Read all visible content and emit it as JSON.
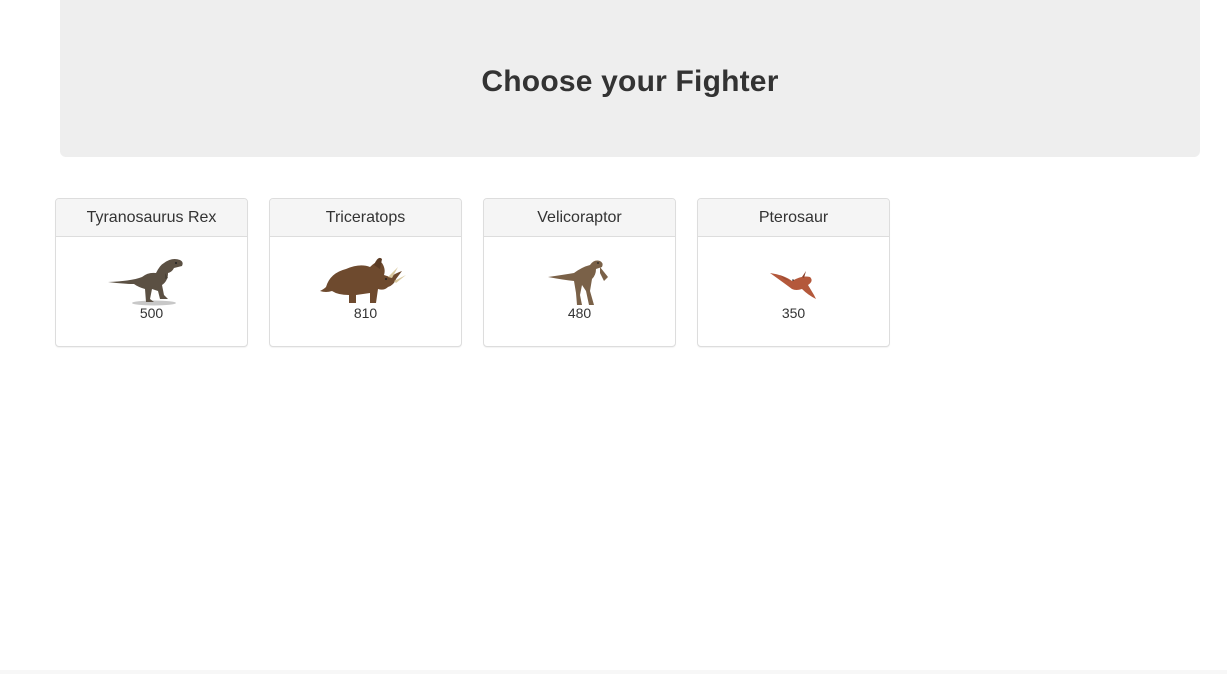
{
  "header": {
    "title": "Choose your Fighter"
  },
  "fighters": [
    {
      "name": "Tyranosaurus Rex",
      "hp": "500",
      "icon": "trex-icon",
      "color": "#5b5043"
    },
    {
      "name": "Triceratops",
      "hp": "810",
      "icon": "triceratops-icon",
      "color": "#6e4a2e"
    },
    {
      "name": "Velicoraptor",
      "hp": "480",
      "icon": "velociraptor-icon",
      "color": "#7a6148"
    },
    {
      "name": "Pterosaur",
      "hp": "350",
      "icon": "pterosaur-icon",
      "color": "#b4583b"
    }
  ]
}
